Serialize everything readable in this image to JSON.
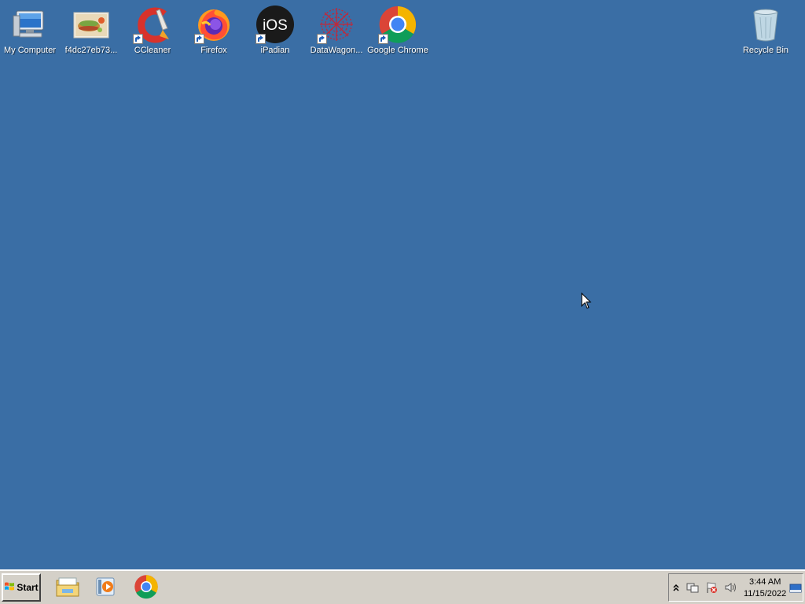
{
  "desktop": {
    "background_color": "#3a6ea5",
    "icons": [
      {
        "label": "My Computer",
        "icon": "computer-icon",
        "shortcut": false
      },
      {
        "label": "f4dc27eb73...",
        "icon": "image-file-icon",
        "shortcut": false
      },
      {
        "label": "CCleaner",
        "icon": "ccleaner-icon",
        "shortcut": true
      },
      {
        "label": "Firefox",
        "icon": "firefox-icon",
        "shortcut": true
      },
      {
        "label": "iPadian",
        "icon": "ipadian-icon",
        "shortcut": true,
        "icon_text": "iOS"
      },
      {
        "label": "DataWagon...",
        "icon": "datawagon-icon",
        "shortcut": true
      },
      {
        "label": "Google Chrome",
        "icon": "chrome-icon",
        "shortcut": true
      },
      {
        "label": "Recycle Bin",
        "icon": "recycle-bin-icon",
        "shortcut": false
      }
    ]
  },
  "taskbar": {
    "start_label": "Start",
    "pinned": [
      {
        "icon": "file-explorer-icon"
      },
      {
        "icon": "media-player-icon"
      },
      {
        "icon": "chrome-icon"
      }
    ],
    "tray": {
      "icons": [
        "show-hidden-icons-icon",
        "network-icon",
        "action-center-flag-icon",
        "volume-icon"
      ],
      "time": "3:44 AM",
      "date": "11/15/2022"
    }
  }
}
